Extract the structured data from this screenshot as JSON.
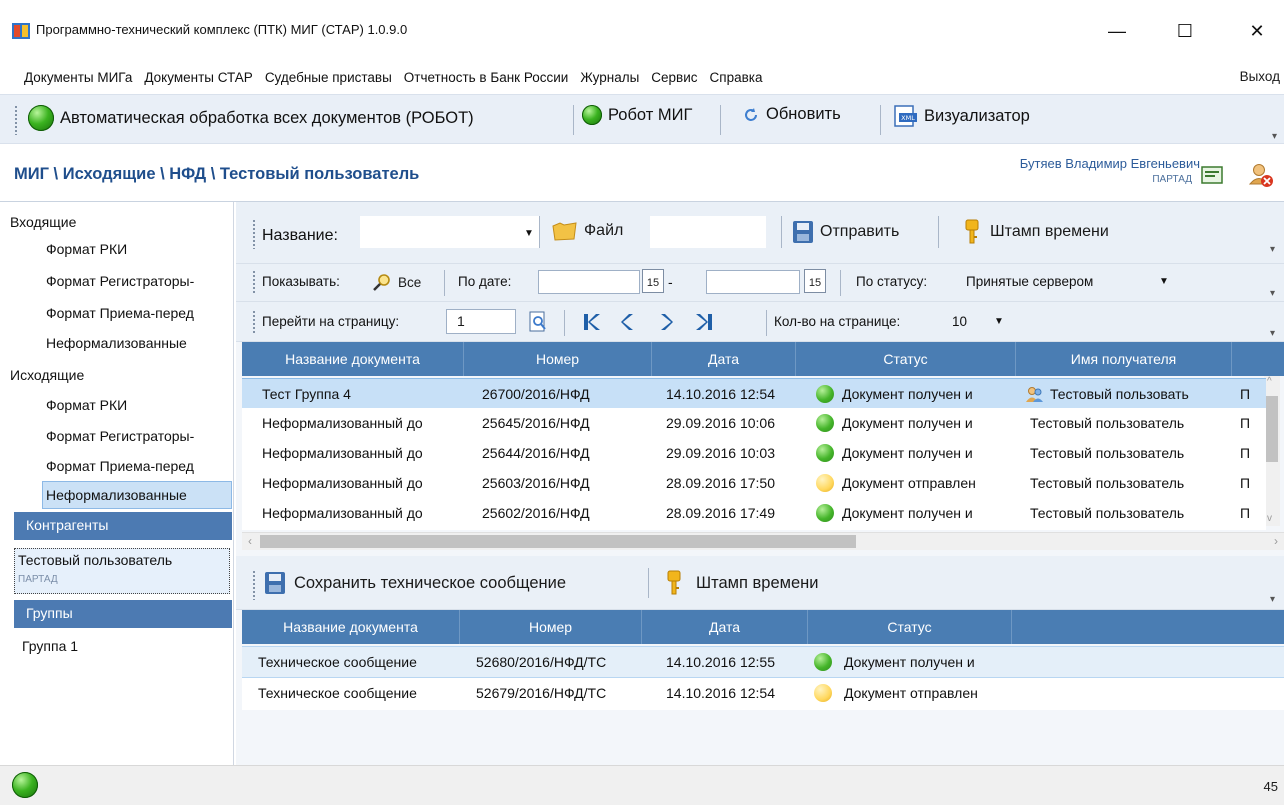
{
  "window": {
    "title": "Программно-технический комплекс (ПТК) МИГ (СТАР) 1.0.9.0",
    "minimize": "—",
    "maximize": "☐",
    "close": "✕"
  },
  "menu": {
    "items": [
      "Документы МИГа",
      "Документы СТАР",
      "Судебные приставы",
      "Отчетность в Банк России",
      "Журналы",
      "Сервис",
      "Справка"
    ],
    "exit": "Выход"
  },
  "toolbar": {
    "auto_label": "Автоматическая обработка всех документов (РОБОТ)",
    "robot_label": "Робот МИГ",
    "refresh_label": "Обновить",
    "visualizer_label": "Визуализатор",
    "xml_icon_text": "XML"
  },
  "header": {
    "breadcrumb": "МИГ \\ Исходящие \\ НФД \\ Тестовый пользователь",
    "user_name": "Бутяев Владимир Евгеньевич",
    "user_org": "ПАРТАД"
  },
  "nav": {
    "incoming_title": "Входящие",
    "incoming": [
      "Формат РКИ",
      "Формат Регистраторы-",
      "Формат Приема-перед",
      "Неформализованные"
    ],
    "outgoing_title": "Исходящие",
    "outgoing": [
      "Формат РКИ",
      "Формат Регистраторы-",
      "Формат Приема-перед",
      "Неформализованные"
    ],
    "contractors_title": "Контрагенты",
    "contractor_name": "Тестовый пользователь",
    "contractor_org": "ПАРТАД",
    "groups_title": "Группы",
    "group_item": "Группа 1"
  },
  "filter": {
    "name_label": "Название:",
    "name_value": "",
    "file_label": "Файл",
    "send_label": "Отправить",
    "stamp_label": "Штамп времени",
    "show_label": "Показывать:",
    "all_label": "Все",
    "by_date_label": "По дате:",
    "date_dash": "-",
    "date_from": "",
    "date_to": "",
    "calendar_day": "15",
    "by_status_label": "По статусу:",
    "status_value": "Принятые сервером"
  },
  "paging": {
    "goto_label": "Перейти на страницу:",
    "page_value": "1",
    "per_page_label": "Кол-во на странице:",
    "per_page_value": "10"
  },
  "documents": {
    "columns": [
      "Название документа",
      "Номер",
      "Дата",
      "Статус",
      "Имя получателя"
    ],
    "rows": [
      {
        "name": "Тест Группа 4",
        "number": "26700/2016/НФД",
        "date": "14.10.2016 12:54",
        "status": "Документ получен и",
        "status_color": "green",
        "recipient": "Тестовый пользовать",
        "extra": "П"
      },
      {
        "name": "Неформализованный до",
        "number": "25645/2016/НФД",
        "date": "29.09.2016 10:06",
        "status": "Документ получен и",
        "status_color": "green",
        "recipient": "Тестовый пользователь",
        "extra": "П"
      },
      {
        "name": "Неформализованный до",
        "number": "25644/2016/НФД",
        "date": "29.09.2016 10:03",
        "status": "Документ получен и",
        "status_color": "green",
        "recipient": "Тестовый пользователь",
        "extra": "П"
      },
      {
        "name": "Неформализованный до",
        "number": "25603/2016/НФД",
        "date": "28.09.2016 17:50",
        "status": "Документ отправлен",
        "status_color": "yellow",
        "recipient": "Тестовый пользователь",
        "extra": "П"
      },
      {
        "name": "Неформализованный до",
        "number": "25602/2016/НФД",
        "date": "28.09.2016 17:49",
        "status": "Документ получен и",
        "status_color": "green",
        "recipient": "Тестовый пользователь",
        "extra": "П"
      }
    ]
  },
  "tech_toolbar": {
    "save_label": "Сохранить техническое сообщение",
    "stamp_label": "Штамп времени"
  },
  "tech_messages": {
    "columns": [
      "Название документа",
      "Номер",
      "Дата",
      "Статус"
    ],
    "rows": [
      {
        "name": "Техническое сообщение",
        "number": "52680/2016/НФД/ТС",
        "date": "14.10.2016 12:55",
        "status": "Документ получен и",
        "status_color": "green"
      },
      {
        "name": "Техническое сообщение",
        "number": "52679/2016/НФД/ТС",
        "date": "14.10.2016 12:54",
        "status": "Документ отправлен",
        "status_color": "yellow"
      }
    ]
  },
  "statusbar": {
    "count": "45"
  },
  "colors": {
    "accent": "#4a7db3",
    "selection": "#c7e0f7",
    "breadcrumb": "#1f4e8c"
  }
}
